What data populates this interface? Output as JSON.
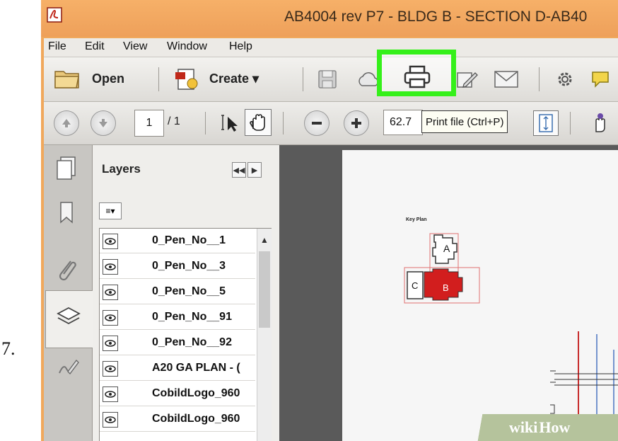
{
  "step": {
    "number": "7."
  },
  "window": {
    "title": "AB4004 rev P7 - BLDG B - SECTION D-AB40"
  },
  "menubar": {
    "items": [
      "File",
      "Edit",
      "View",
      "Window",
      "Help"
    ]
  },
  "toolbar": {
    "open_label": "Open",
    "create_label": "Create ▾"
  },
  "nav_toolbar": {
    "current_page": "1",
    "total_pages": "/ 1",
    "zoom": "62.7",
    "tooltip": "Print file (Ctrl+P)"
  },
  "layers_panel": {
    "title": "Layers",
    "collapse_btn": "◀◀",
    "expand_btn": "▶",
    "options_btn": "≡▾",
    "items": [
      {
        "label": "0_Pen_No__1"
      },
      {
        "label": "0_Pen_No__3"
      },
      {
        "label": "0_Pen_No__5"
      },
      {
        "label": "0_Pen_No__91"
      },
      {
        "label": "0_Pen_No__92"
      },
      {
        "label": "A20 GA PLAN - ("
      },
      {
        "label": "CobildLogo_960"
      },
      {
        "label": "CobildLogo_960"
      }
    ]
  },
  "document": {
    "key_plan_label": "Key Plan",
    "block_a": "A",
    "block_b": "B",
    "block_c": "C"
  },
  "watermark": {
    "wiki": "wiki",
    "how": "How"
  },
  "colors": {
    "highlight": "#35f01a",
    "title_bar": "#f0a85c",
    "block_b": "#d21e1e"
  }
}
